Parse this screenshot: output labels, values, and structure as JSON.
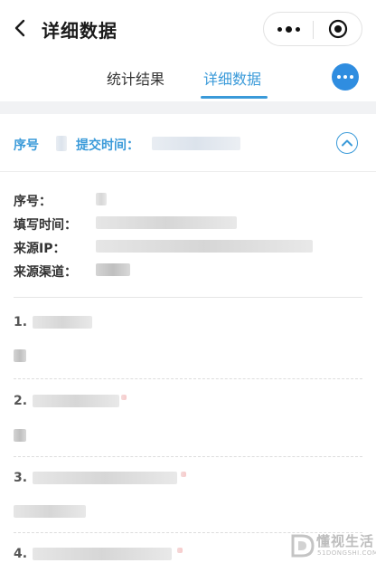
{
  "navbar": {
    "title": "详细数据"
  },
  "tabs": [
    {
      "label": "统计结果",
      "active": false
    },
    {
      "label": "详细数据",
      "active": true
    }
  ],
  "record_header": {
    "seq_label": "序号",
    "time_label": "提交时间："
  },
  "meta": {
    "seq_label": "序号：",
    "time_label": "填写时间：",
    "ip_label": "来源IP：",
    "channel_label": "来源渠道："
  },
  "questions": [
    {
      "num": "1."
    },
    {
      "num": "2."
    },
    {
      "num": "3."
    },
    {
      "num": "4."
    }
  ],
  "watermark": {
    "text": "懂视生活",
    "sub": "51DONGSHI.COM"
  },
  "colors": {
    "accent": "#3a9ad9",
    "fab": "#2f8de0",
    "band": "#f1f2f4"
  }
}
